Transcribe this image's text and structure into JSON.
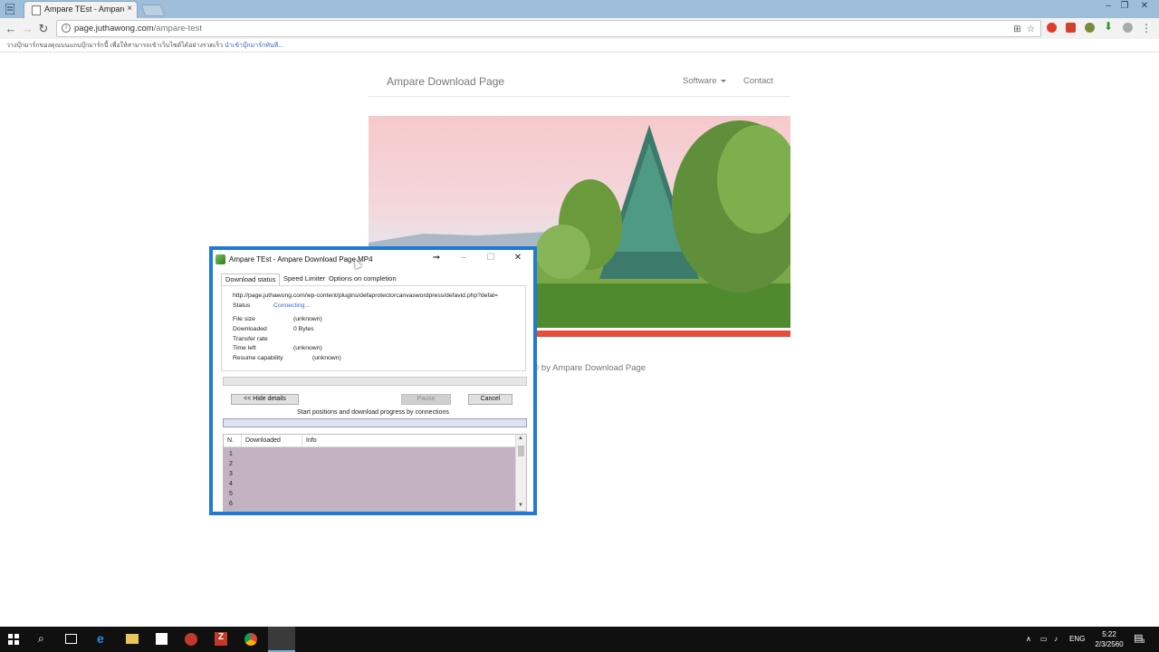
{
  "browser": {
    "tab_title": "Ampare TEst - Ampare D",
    "tab_close": "×",
    "url_host": "page.juthawong.com",
    "url_path": "/ampare-test",
    "infobar_text": "วางบุ๊กมาร์กของคุณบนแถบบุ๊กมาร์กนี้ เพื่อให้สามารถเข้าเว็บไซต์ได้อย่างรวดเร็ว",
    "infobar_link": "นำเข้าบุ๊กมาร์กทันที...",
    "window_controls": [
      "–",
      "❐",
      "✕"
    ]
  },
  "site": {
    "brand": "Ampare Download Page",
    "nav": [
      {
        "label": "Software"
      },
      {
        "label": "Contact"
      }
    ],
    "footer": "t © by Ampare Download Page"
  },
  "dialog": {
    "title": "Ampare TEst - Ampare Download Page.MP4",
    "tabs": [
      "Download status",
      "Speed Limiter",
      "Options on completion"
    ],
    "url": "http://page.juthawong.com/wp-content/plugins/defaprotectorcanvaswordpress/defavid.php?defat=",
    "status_label": "Status",
    "status_value": "Connecting...",
    "fields": [
      {
        "label": "File size",
        "value": "(unknown)"
      },
      {
        "label": "Downloaded",
        "value": "0 Bytes"
      },
      {
        "label": "Transfer rate",
        "value": ""
      },
      {
        "label": "Time left",
        "value": "(unknown)"
      },
      {
        "label": "Resume capability",
        "value": "(unknown)"
      }
    ],
    "buttons": {
      "hide_details": "<< Hide details",
      "pause": "Pause",
      "cancel": "Cancel"
    },
    "connections_caption": "Start positions and download progress by connections",
    "table_headers": [
      "N.",
      "Downloaded",
      "Info"
    ],
    "table_rows": [
      "1",
      "2",
      "3",
      "4",
      "5",
      "6"
    ],
    "progress": 0
  },
  "taskbar": {
    "language": "ENG",
    "time": "5:22",
    "date": "2/3/2560",
    "notification_count": "3"
  }
}
